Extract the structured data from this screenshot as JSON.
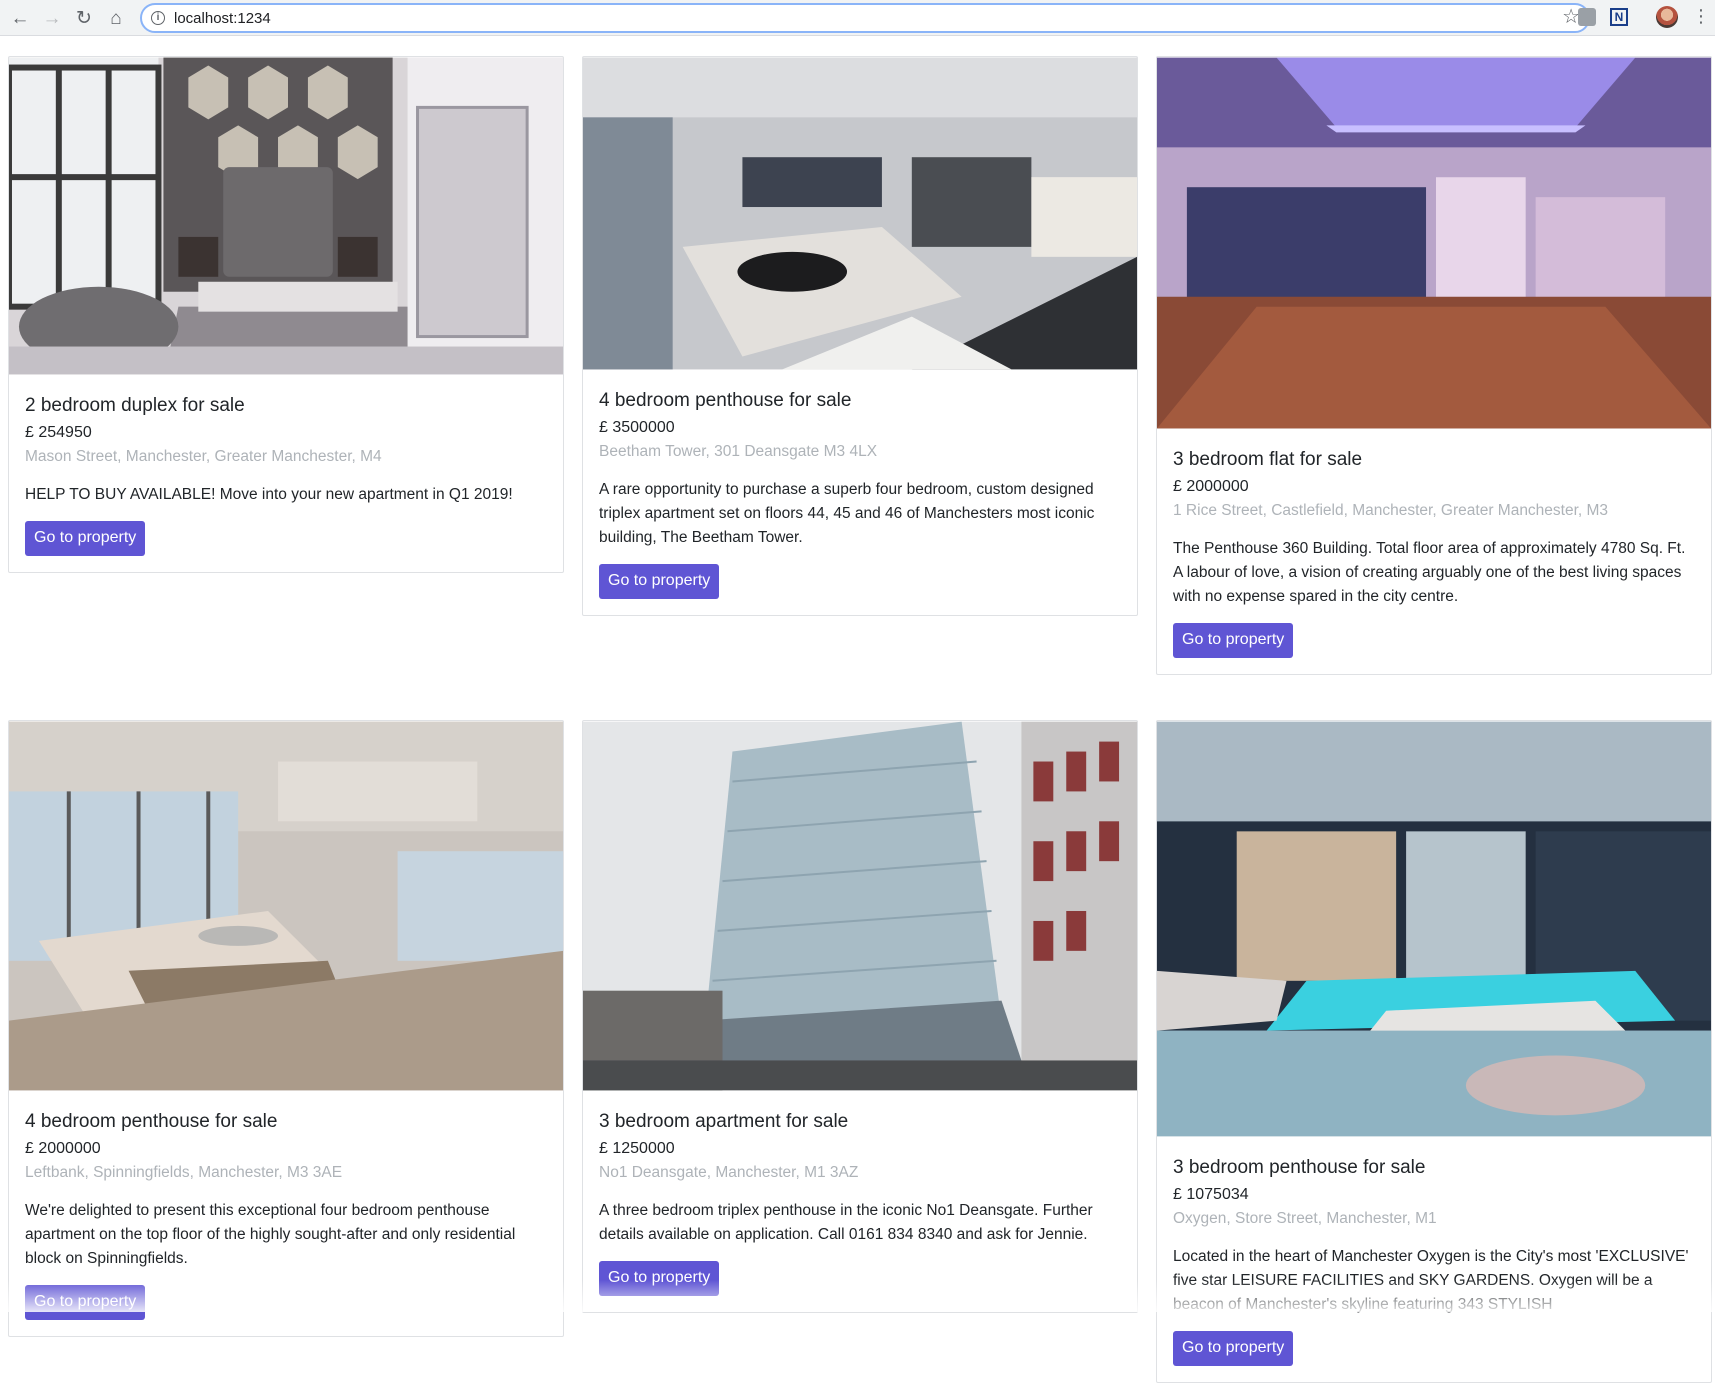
{
  "browser": {
    "url": "localhost:1234",
    "back_icon": "arrow-left-icon",
    "forward_icon": "arrow-right-icon",
    "reload_icon": "reload-icon",
    "home_icon": "home-icon"
  },
  "colors": {
    "button": "#5f55d4",
    "address": "#aeb3b8",
    "card_border": "#dfe1e4"
  },
  "currency": "£",
  "button_label": "Go to property",
  "cards": [
    {
      "title": "2 bedroom duplex for sale",
      "price": "£ 254950",
      "address": "Mason Street, Manchester, Greater Manchester, M4",
      "description": "HELP TO BUY AVAILABLE! Move into your new apartment in Q1 2019!"
    },
    {
      "title": "4 bedroom penthouse for sale",
      "price": "£ 3500000",
      "address": "Beetham Tower, 301 Deansgate M3 4LX",
      "description": "A rare opportunity to purchase a superb four bedroom, custom designed triplex apartment set on floors 44, 45 and 46 of Manchesters most iconic building, The Beetham Tower."
    },
    {
      "title": "3 bedroom flat for sale",
      "price": "£ 2000000",
      "address": "1 Rice Street, Castlefield, Manchester, Greater Manchester, M3",
      "description": "The Penthouse 360 Building. Total floor area of approximately 4780 Sq. Ft. A labour of love, a vision of creating arguably one of the best living spaces with no expense spared in the city centre."
    },
    {
      "title": "4 bedroom penthouse for sale",
      "price": "£ 2000000",
      "address": "Leftbank, Spinningfields, Manchester, M3 3AE",
      "description": "We're delighted to present this exceptional four bedroom penthouse apartment on the top floor of the highly sought-after and only residential block on Spinningfields."
    },
    {
      "title": "3 bedroom apartment for sale",
      "price": "£ 1250000",
      "address": "No1 Deansgate, Manchester, M1 3AZ",
      "description": "A three bedroom triplex penthouse in the iconic No1 Deansgate. Further details available on application. Call 0161 834 8340 and ask for Jennie."
    },
    {
      "title": "3 bedroom penthouse for sale",
      "price": "£ 1075034",
      "address": "Oxygen, Store Street, Manchester, M1",
      "description": "Located in the heart of Manchester Oxygen is the City's most 'EXCLUSIVE' five star LEISURE FACILITIES and SKY GARDENS. Oxygen will be a beacon of Manchester's skyline featuring 343 STYLISH"
    }
  ]
}
